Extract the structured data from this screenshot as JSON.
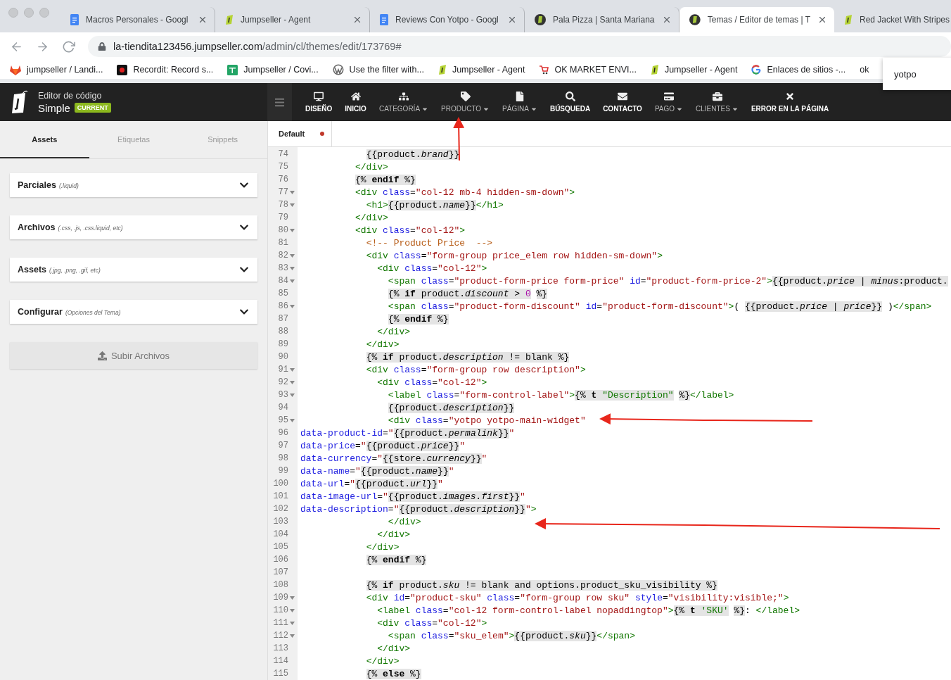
{
  "browser": {
    "tabs": [
      {
        "title": "Macros Personales - Googl",
        "selected": false
      },
      {
        "title": "Jumpseller - Agent",
        "selected": false
      },
      {
        "title": "Reviews Con Yotpo - Googl",
        "selected": false
      },
      {
        "title": "Pala Pizza | Santa Mariana",
        "selected": false
      },
      {
        "title": "Temas / Editor de temas | T",
        "selected": true
      },
      {
        "title": "Red Jacket With Stripes",
        "selected": false
      }
    ],
    "url": {
      "host": "la-tiendita123456.jumpseller.com",
      "path": "/admin/cl/themes/edit/173769#"
    },
    "bookmarks": [
      "jumpseller / Landi...",
      "Recordit: Record s...",
      "Jumpseller / Covi...",
      "Use the filter with...",
      "Jumpseller - Agent",
      "OK MARKET ENVI...",
      "Jumpseller - Agent",
      "Enlaces de sitios -...",
      "ok"
    ],
    "suggestion": "yotpo"
  },
  "header": {
    "title": "Editor de código",
    "theme": "Simple",
    "badge": "CURRENT",
    "nav": [
      {
        "label": "DISEÑO",
        "dropdown": false
      },
      {
        "label": "INICIO",
        "dropdown": false
      },
      {
        "label": "CATEGORÍA",
        "dropdown": true
      },
      {
        "label": "PRODUCTO",
        "dropdown": true
      },
      {
        "label": "PÁGINA",
        "dropdown": true
      },
      {
        "label": "BÚSQUEDA",
        "dropdown": false
      },
      {
        "label": "CONTACTO",
        "dropdown": false
      },
      {
        "label": "PAGO",
        "dropdown": true
      },
      {
        "label": "CLIENTES",
        "dropdown": true
      },
      {
        "label": "ERROR EN LA PÁGINA",
        "dropdown": false
      }
    ]
  },
  "sidebar": {
    "tabs": [
      {
        "label": "Assets",
        "selected": true
      },
      {
        "label": "Etiquetas",
        "selected": false
      },
      {
        "label": "Snippets",
        "selected": false
      }
    ],
    "sections": [
      {
        "title": "Parciales",
        "hint": "(.liquid)"
      },
      {
        "title": "Archivos",
        "hint": "(.css, .js, .css.liquid, etc)"
      },
      {
        "title": "Assets",
        "hint": "(.jpg, .png, .gif, etc)"
      },
      {
        "title": "Configurar",
        "hint": "(Opciones del Tema)"
      }
    ],
    "upload": "Subir Archivos"
  },
  "editor": {
    "tabs": [
      {
        "label": "Default",
        "modified": true
      }
    ],
    "lines": [
      {
        "num": "74",
        "fold": false,
        "tokens": [
          {
            "kind": "liquid",
            "text": "            {{product.*brand*}}"
          }
        ]
      },
      {
        "num": "75",
        "fold": false,
        "tokens": [
          {
            "kind": "tag",
            "text": "          </div>"
          }
        ]
      },
      {
        "num": "76",
        "fold": false,
        "tokens": [
          {
            "kind": "liquid",
            "text": "          {% **endif** %}"
          }
        ]
      },
      {
        "num": "77",
        "fold": true,
        "tokens": [
          {
            "kind": "tag",
            "text": "          <div "
          },
          {
            "kind": "attr",
            "text": "class"
          },
          {
            "kind": "plain",
            "text": "="
          },
          {
            "kind": "string",
            "text": "\"col-12 mb-4 hidden-sm-down\""
          },
          {
            "kind": "tag",
            "text": ">"
          }
        ]
      },
      {
        "num": "78",
        "fold": true,
        "tokens": [
          {
            "kind": "tag",
            "text": "            <h1>"
          },
          {
            "kind": "liquid",
            "text": "{{product.*name*}}"
          },
          {
            "kind": "tag",
            "text": "</h1>"
          }
        ]
      },
      {
        "num": "79",
        "fold": false,
        "tokens": [
          {
            "kind": "tag",
            "text": "          </div>"
          }
        ]
      },
      {
        "num": "80",
        "fold": true,
        "tokens": [
          {
            "kind": "tag",
            "text": "          <div "
          },
          {
            "kind": "attr",
            "text": "class"
          },
          {
            "kind": "plain",
            "text": "="
          },
          {
            "kind": "string",
            "text": "\"col-12\""
          },
          {
            "kind": "tag",
            "text": ">"
          }
        ]
      },
      {
        "num": "81",
        "fold": false,
        "tokens": [
          {
            "kind": "comment",
            "text": "            <!-- Product Price  -->"
          }
        ]
      },
      {
        "num": "82",
        "fold": true,
        "tokens": [
          {
            "kind": "tag",
            "text": "            <div "
          },
          {
            "kind": "attr",
            "text": "class"
          },
          {
            "kind": "plain",
            "text": "="
          },
          {
            "kind": "string",
            "text": "\"form-group price_elem row hidden-sm-down\""
          },
          {
            "kind": "tag",
            "text": ">"
          }
        ]
      },
      {
        "num": "83",
        "fold": true,
        "tokens": [
          {
            "kind": "tag",
            "text": "              <div "
          },
          {
            "kind": "attr",
            "text": "class"
          },
          {
            "kind": "plain",
            "text": "="
          },
          {
            "kind": "string",
            "text": "\"col-12\""
          },
          {
            "kind": "tag",
            "text": ">"
          }
        ]
      },
      {
        "num": "84",
        "fold": true,
        "tokens": [
          {
            "kind": "tag",
            "text": "                <span "
          },
          {
            "kind": "attr",
            "text": "class"
          },
          {
            "kind": "plain",
            "text": "="
          },
          {
            "kind": "string",
            "text": "\"product-form-price form-price\""
          },
          {
            "kind": "attr",
            "text": " id"
          },
          {
            "kind": "plain",
            "text": "="
          },
          {
            "kind": "string",
            "text": "\"product-form-price-2\""
          },
          {
            "kind": "tag",
            "text": ">"
          },
          {
            "kind": "liquid",
            "text": "{{product.*price* | *minus*:product."
          }
        ]
      },
      {
        "num": "85",
        "fold": false,
        "tokens": [
          {
            "kind": "liquid",
            "text": "                {% **if** product.*discount* > "
          },
          {
            "kind": "number",
            "text": "0"
          },
          {
            "kind": "liquid",
            "text": " %}"
          }
        ]
      },
      {
        "num": "86",
        "fold": true,
        "tokens": [
          {
            "kind": "tag",
            "text": "                <span "
          },
          {
            "kind": "attr",
            "text": "class"
          },
          {
            "kind": "plain",
            "text": "="
          },
          {
            "kind": "string",
            "text": "\"product-form-discount\""
          },
          {
            "kind": "attr",
            "text": " id"
          },
          {
            "kind": "plain",
            "text": "="
          },
          {
            "kind": "string",
            "text": "\"product-form-discount\""
          },
          {
            "kind": "tag",
            "text": ">"
          },
          {
            "kind": "plain",
            "text": "( "
          },
          {
            "kind": "liquid",
            "text": "{{product.*price* | *price*}}"
          },
          {
            "kind": "plain",
            "text": " )"
          },
          {
            "kind": "tag",
            "text": "</span>"
          }
        ]
      },
      {
        "num": "87",
        "fold": false,
        "tokens": [
          {
            "kind": "liquid",
            "text": "                {% **endif** %}"
          }
        ]
      },
      {
        "num": "88",
        "fold": false,
        "tokens": [
          {
            "kind": "tag",
            "text": "              </div>"
          }
        ]
      },
      {
        "num": "89",
        "fold": false,
        "tokens": [
          {
            "kind": "tag",
            "text": "            </div>"
          }
        ]
      },
      {
        "num": "90",
        "fold": false,
        "tokens": [
          {
            "kind": "liquid",
            "text": "            {% **if** product.*description* != blank %}"
          }
        ]
      },
      {
        "num": "91",
        "fold": true,
        "tokens": [
          {
            "kind": "tag",
            "text": "            <div "
          },
          {
            "kind": "attr",
            "text": "class"
          },
          {
            "kind": "plain",
            "text": "="
          },
          {
            "kind": "string",
            "text": "\"form-group row description\""
          },
          {
            "kind": "tag",
            "text": ">"
          }
        ]
      },
      {
        "num": "92",
        "fold": true,
        "tokens": [
          {
            "kind": "tag",
            "text": "              <div "
          },
          {
            "kind": "attr",
            "text": "class"
          },
          {
            "kind": "plain",
            "text": "="
          },
          {
            "kind": "string",
            "text": "\"col-12\""
          },
          {
            "kind": "tag",
            "text": ">"
          }
        ]
      },
      {
        "num": "93",
        "fold": true,
        "tokens": [
          {
            "kind": "tag",
            "text": "                <label "
          },
          {
            "kind": "attr",
            "text": "class"
          },
          {
            "kind": "plain",
            "text": "="
          },
          {
            "kind": "string",
            "text": "\"form-control-label\""
          },
          {
            "kind": "tag",
            "text": ">"
          },
          {
            "kind": "liquid",
            "text": "{% **t** "
          },
          {
            "kind": "liquid-string",
            "text": "\"Description\""
          },
          {
            "kind": "liquid",
            "text": " %}"
          },
          {
            "kind": "tag",
            "text": "</label>"
          }
        ]
      },
      {
        "num": "94",
        "fold": false,
        "tokens": [
          {
            "kind": "liquid",
            "text": "                {{product.*description*}}"
          }
        ]
      },
      {
        "num": "95",
        "fold": true,
        "tokens": [
          {
            "kind": "tag",
            "text": "                <div "
          },
          {
            "kind": "attr",
            "text": "class"
          },
          {
            "kind": "plain",
            "text": "="
          },
          {
            "kind": "string",
            "text": "\"yotpo yotpo-main-widget\""
          }
        ]
      },
      {
        "num": "96",
        "fold": false,
        "tokens": [
          {
            "kind": "attr",
            "text": "data-product-id"
          },
          {
            "kind": "plain",
            "text": "="
          },
          {
            "kind": "string",
            "text": "\""
          },
          {
            "kind": "liquid",
            "text": "{{product.*permalink*}}"
          },
          {
            "kind": "string",
            "text": "\""
          }
        ]
      },
      {
        "num": "97",
        "fold": false,
        "tokens": [
          {
            "kind": "attr",
            "text": "data-price"
          },
          {
            "kind": "plain",
            "text": "="
          },
          {
            "kind": "string",
            "text": "\""
          },
          {
            "kind": "liquid",
            "text": "{{product.*price*}}"
          },
          {
            "kind": "string",
            "text": "\""
          }
        ]
      },
      {
        "num": "98",
        "fold": false,
        "tokens": [
          {
            "kind": "attr",
            "text": "data-currency"
          },
          {
            "kind": "plain",
            "text": "="
          },
          {
            "kind": "string",
            "text": "\""
          },
          {
            "kind": "liquid",
            "text": "{{store.*currency*}}"
          },
          {
            "kind": "string",
            "text": "\""
          }
        ]
      },
      {
        "num": "99",
        "fold": false,
        "tokens": [
          {
            "kind": "attr",
            "text": "data-name"
          },
          {
            "kind": "plain",
            "text": "="
          },
          {
            "kind": "string",
            "text": "\""
          },
          {
            "kind": "liquid",
            "text": "{{product.*name*}}"
          },
          {
            "kind": "string",
            "text": "\""
          }
        ]
      },
      {
        "num": "100",
        "fold": false,
        "tokens": [
          {
            "kind": "attr",
            "text": "data-url"
          },
          {
            "kind": "plain",
            "text": "="
          },
          {
            "kind": "string",
            "text": "\""
          },
          {
            "kind": "liquid",
            "text": "{{product.*url*}}"
          },
          {
            "kind": "string",
            "text": "\""
          }
        ]
      },
      {
        "num": "101",
        "fold": false,
        "tokens": [
          {
            "kind": "attr",
            "text": "data-image-url"
          },
          {
            "kind": "plain",
            "text": "="
          },
          {
            "kind": "string",
            "text": "\""
          },
          {
            "kind": "liquid",
            "text": "{{product.*images.first*}}"
          },
          {
            "kind": "string",
            "text": "\""
          }
        ]
      },
      {
        "num": "102",
        "fold": false,
        "tokens": [
          {
            "kind": "attr",
            "text": "data-description"
          },
          {
            "kind": "plain",
            "text": "="
          },
          {
            "kind": "string",
            "text": "\""
          },
          {
            "kind": "liquid",
            "text": "{{product.*description*}}"
          },
          {
            "kind": "string",
            "text": "\""
          },
          {
            "kind": "tag",
            "text": ">"
          }
        ]
      },
      {
        "num": "103",
        "fold": false,
        "tokens": [
          {
            "kind": "tag",
            "text": "                </div>"
          }
        ]
      },
      {
        "num": "104",
        "fold": false,
        "tokens": [
          {
            "kind": "tag",
            "text": "              </div>"
          }
        ]
      },
      {
        "num": "105",
        "fold": false,
        "tokens": [
          {
            "kind": "tag",
            "text": "            </div>"
          }
        ]
      },
      {
        "num": "106",
        "fold": false,
        "tokens": [
          {
            "kind": "liquid",
            "text": "            {% **endif** %}"
          }
        ]
      },
      {
        "num": "107",
        "fold": false
      },
      {
        "num": "108",
        "fold": false,
        "tokens": [
          {
            "kind": "liquid",
            "text": "            {% **if** product.*sku* != blank and options.product_sku_visibility %}"
          }
        ]
      },
      {
        "num": "109",
        "fold": true,
        "tokens": [
          {
            "kind": "tag",
            "text": "            <div "
          },
          {
            "kind": "attr",
            "text": "id"
          },
          {
            "kind": "plain",
            "text": "="
          },
          {
            "kind": "string",
            "text": "\"product-sku\""
          },
          {
            "kind": "attr",
            "text": " class"
          },
          {
            "kind": "plain",
            "text": "="
          },
          {
            "kind": "string",
            "text": "\"form-group row sku\""
          },
          {
            "kind": "attr",
            "text": " style"
          },
          {
            "kind": "plain",
            "text": "="
          },
          {
            "kind": "string",
            "text": "\"visibility:visible;\""
          },
          {
            "kind": "tag",
            "text": ">"
          }
        ]
      },
      {
        "num": "110",
        "fold": true,
        "tokens": [
          {
            "kind": "tag",
            "text": "              <label "
          },
          {
            "kind": "attr",
            "text": "class"
          },
          {
            "kind": "plain",
            "text": "="
          },
          {
            "kind": "string",
            "text": "\"col-12 form-control-label nopaddingtop\""
          },
          {
            "kind": "tag",
            "text": ">"
          },
          {
            "kind": "liquid",
            "text": "{% **t** "
          },
          {
            "kind": "liquid-string",
            "text": "'SKU'"
          },
          {
            "kind": "liquid",
            "text": " %}"
          },
          {
            "kind": "plain",
            "text": ": "
          },
          {
            "kind": "tag",
            "text": "</label>"
          }
        ]
      },
      {
        "num": "111",
        "fold": true,
        "tokens": [
          {
            "kind": "tag",
            "text": "              <div "
          },
          {
            "kind": "attr",
            "text": "class"
          },
          {
            "kind": "plain",
            "text": "="
          },
          {
            "kind": "string",
            "text": "\"col-12\""
          },
          {
            "kind": "tag",
            "text": ">"
          }
        ]
      },
      {
        "num": "112",
        "fold": true,
        "tokens": [
          {
            "kind": "tag",
            "text": "                <span "
          },
          {
            "kind": "attr",
            "text": "class"
          },
          {
            "kind": "plain",
            "text": "="
          },
          {
            "kind": "string",
            "text": "\"sku_elem\""
          },
          {
            "kind": "tag",
            "text": ">"
          },
          {
            "kind": "liquid",
            "text": "{{product.*sku*}}"
          },
          {
            "kind": "tag",
            "text": "</span>"
          }
        ]
      },
      {
        "num": "113",
        "fold": false,
        "tokens": [
          {
            "kind": "tag",
            "text": "              </div>"
          }
        ]
      },
      {
        "num": "114",
        "fold": false,
        "tokens": [
          {
            "kind": "tag",
            "text": "            </div>"
          }
        ]
      },
      {
        "num": "115",
        "fold": false,
        "tokens": [
          {
            "kind": "liquid",
            "text": "            {% **else** %}"
          }
        ]
      }
    ]
  }
}
